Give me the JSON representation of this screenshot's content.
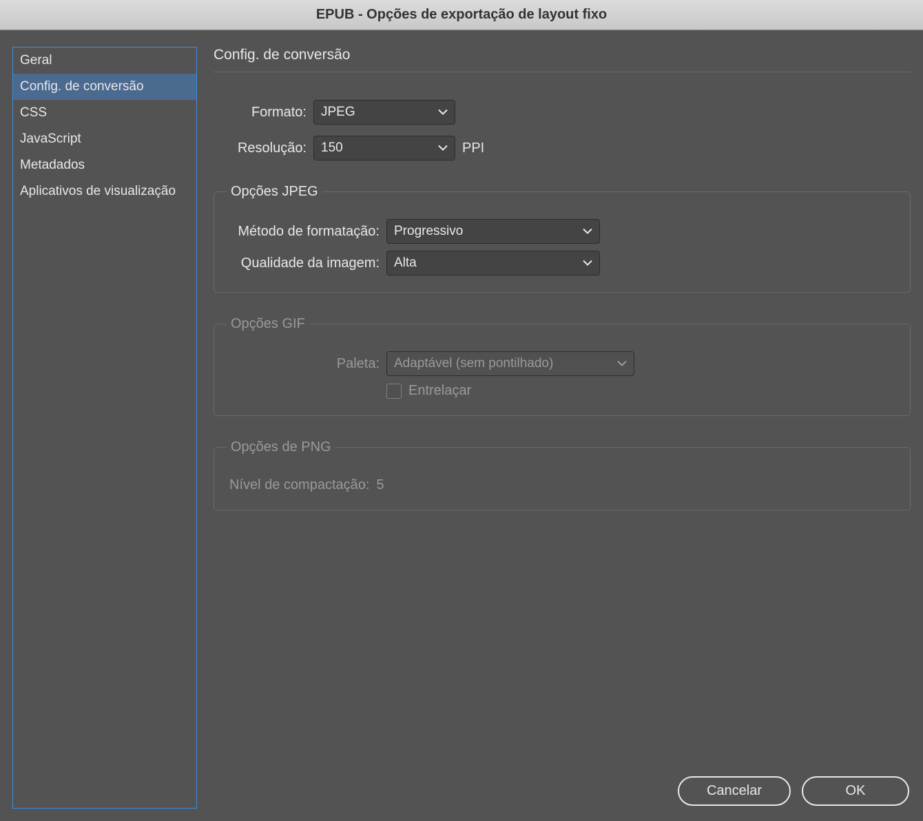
{
  "title": "EPUB - Opções de exportação de layout fixo",
  "sidebar": {
    "items": [
      {
        "label": "Geral"
      },
      {
        "label": "Config. de conversão"
      },
      {
        "label": "CSS"
      },
      {
        "label": "JavaScript"
      },
      {
        "label": "Metadados"
      },
      {
        "label": "Aplicativos de visualização"
      }
    ],
    "selected_index": 1
  },
  "panel": {
    "header": "Config. de conversão",
    "format_label": "Formato:",
    "format_value": "JPEG",
    "resolution_label": "Resolução:",
    "resolution_value": "150",
    "resolution_suffix": "PPI",
    "jpeg": {
      "legend": "Opções JPEG",
      "method_label": "Método de formatação:",
      "method_value": "Progressivo",
      "quality_label": "Qualidade da imagem:",
      "quality_value": "Alta"
    },
    "gif": {
      "legend": "Opções GIF",
      "palette_label": "Paleta:",
      "palette_value": "Adaptável (sem pontilhado)",
      "interlace_label": "Entrelaçar",
      "interlace_checked": false
    },
    "png": {
      "legend": "Opções de PNG",
      "compression_label": "Nível de compactação:",
      "compression_value": "5"
    }
  },
  "footer": {
    "cancel": "Cancelar",
    "ok": "OK"
  }
}
